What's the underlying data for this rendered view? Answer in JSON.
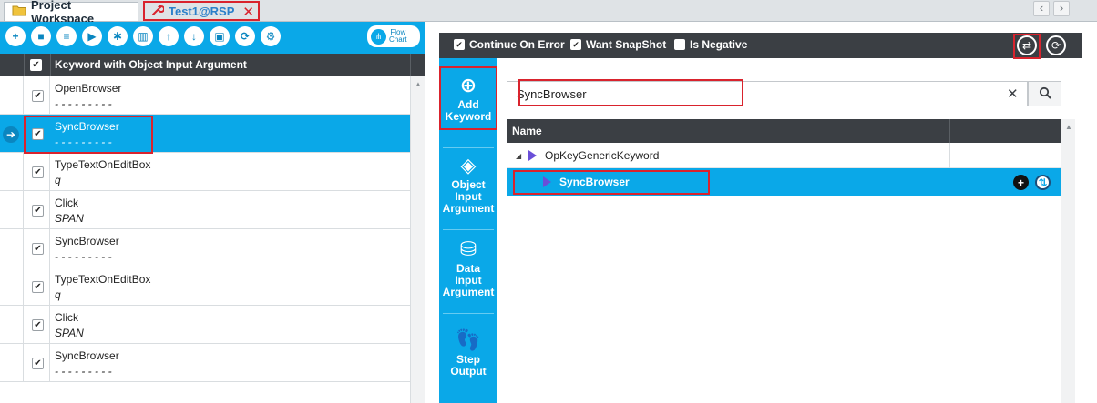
{
  "tabs": {
    "workspace": "Project Workspace",
    "test": "Test1@RSP"
  },
  "nav": {
    "prev": "‹",
    "next": "›"
  },
  "toolbar": {
    "flow_chart_line1": "Flow",
    "flow_chart_line2": "Chart"
  },
  "grid": {
    "header": "Keyword with Object Input Argument",
    "rows": [
      {
        "keyword": "OpenBrowser",
        "arg": "- - - - - - - - -",
        "selected": false
      },
      {
        "keyword": "SyncBrowser",
        "arg": "- - - - - - - - -",
        "selected": true
      },
      {
        "keyword": "TypeTextOnEditBox",
        "arg": "q",
        "selected": false
      },
      {
        "keyword": "Click",
        "arg": "SPAN",
        "selected": false
      },
      {
        "keyword": "SyncBrowser",
        "arg": "- - - - - - - - -",
        "selected": false
      },
      {
        "keyword": "TypeTextOnEditBox",
        "arg": "q",
        "selected": false
      },
      {
        "keyword": "Click",
        "arg": "SPAN",
        "selected": false
      },
      {
        "keyword": "SyncBrowser",
        "arg": "- - - - - - - - -",
        "selected": false
      }
    ]
  },
  "options": {
    "continue_on_error": "Continue On Error",
    "want_snapshot": "Want SnapShot",
    "is_negative": "Is Negative"
  },
  "vtabs": {
    "add_keyword_1": "Add",
    "add_keyword_2": "Keyword",
    "object_input_1": "Object",
    "object_input_2": "Input",
    "object_input_3": "Argument",
    "data_input_1": "Data",
    "data_input_2": "Input",
    "data_input_3": "Argument",
    "step_output_1": "Step",
    "step_output_2": "Output"
  },
  "search": {
    "value": "SyncBrowser",
    "clear": "✕"
  },
  "tree": {
    "header": "Name",
    "group": "OpKeyGenericKeyword",
    "item": "SyncBrowser"
  },
  "colors": {
    "accent": "#0aa8e8",
    "dark": "#3b3f44",
    "highlight": "#d9232d"
  }
}
